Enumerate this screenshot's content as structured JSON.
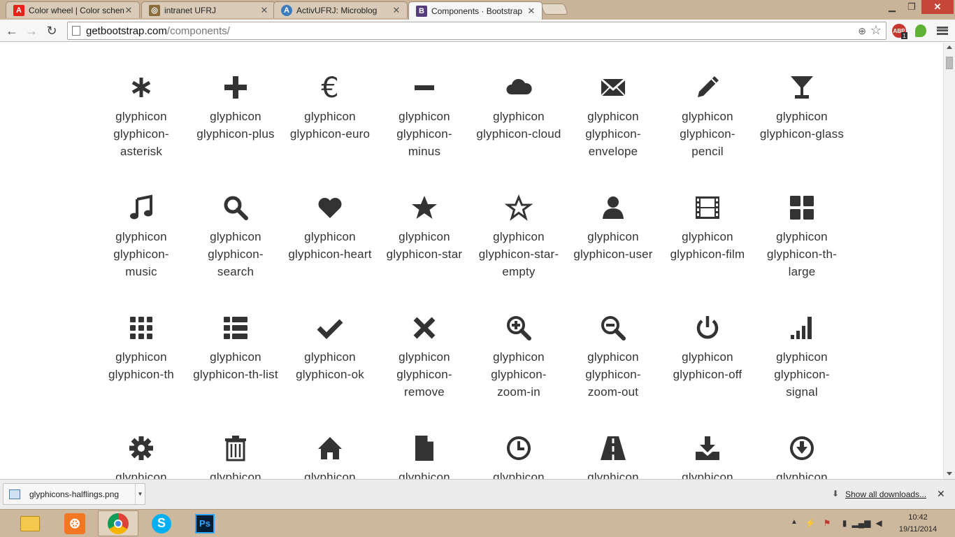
{
  "browser": {
    "tabs": [
      {
        "title": "Color wheel | Color schem",
        "favicon_name": "adobe-icon",
        "favicon_color": "#e1251b",
        "favicon_glyph": "A"
      },
      {
        "title": "intranet UFRJ",
        "favicon_name": "ufrj-icon",
        "favicon_color": "#8a6d3b",
        "favicon_glyph": "◎"
      },
      {
        "title": "ActivUFRJ: Microblog",
        "favicon_name": "activufrj-icon",
        "favicon_color": "#3b7bbf",
        "favicon_glyph": "A"
      },
      {
        "title": "Components · Bootstrap",
        "favicon_name": "bootstrap-icon",
        "favicon_color": "#563d7c",
        "favicon_glyph": "B"
      }
    ],
    "url_host": "getbootstrap.com",
    "url_path": "/components/",
    "extension_badge": "1"
  },
  "page": {
    "glyphicon_rows": [
      [
        {
          "icon": "asterisk",
          "label": "glyphicon glyphicon-asterisk"
        },
        {
          "icon": "plus",
          "label": "glyphicon glyphicon-plus"
        },
        {
          "icon": "euro",
          "label": "glyphicon glyphicon-euro"
        },
        {
          "icon": "minus",
          "label": "glyphicon glyphicon-minus"
        },
        {
          "icon": "cloud",
          "label": "glyphicon glyphicon-cloud"
        },
        {
          "icon": "envelope",
          "label": "glyphicon glyphicon-envelope"
        },
        {
          "icon": "pencil",
          "label": "glyphicon glyphicon-pencil"
        },
        {
          "icon": "glass",
          "label": "glyphicon glyphicon-glass"
        }
      ],
      [
        {
          "icon": "music",
          "label": "glyphicon glyphicon-music"
        },
        {
          "icon": "search",
          "label": "glyphicon glyphicon-search"
        },
        {
          "icon": "heart",
          "label": "glyphicon glyphicon-heart"
        },
        {
          "icon": "star",
          "label": "glyphicon glyphicon-star"
        },
        {
          "icon": "star-empty",
          "label": "glyphicon glyphicon-star-empty"
        },
        {
          "icon": "user",
          "label": "glyphicon glyphicon-user"
        },
        {
          "icon": "film",
          "label": "glyphicon glyphicon-film"
        },
        {
          "icon": "th-large",
          "label": "glyphicon glyphicon-th-large"
        }
      ],
      [
        {
          "icon": "th",
          "label": "glyphicon glyphicon-th"
        },
        {
          "icon": "th-list",
          "label": "glyphicon glyphicon-th-list"
        },
        {
          "icon": "ok",
          "label": "glyphicon glyphicon-ok"
        },
        {
          "icon": "remove",
          "label": "glyphicon glyphicon-remove"
        },
        {
          "icon": "zoom-in",
          "label": "glyphicon glyphicon-zoom-in"
        },
        {
          "icon": "zoom-out",
          "label": "glyphicon glyphicon-zoom-out"
        },
        {
          "icon": "off",
          "label": "glyphicon glyphicon-off"
        },
        {
          "icon": "signal",
          "label": "glyphicon glyphicon-signal"
        }
      ],
      [
        {
          "icon": "cog",
          "label": "glyphicon"
        },
        {
          "icon": "trash",
          "label": "glyphicon"
        },
        {
          "icon": "home",
          "label": "glyphicon"
        },
        {
          "icon": "file",
          "label": "glyphicon"
        },
        {
          "icon": "time",
          "label": "glyphicon"
        },
        {
          "icon": "road",
          "label": "glyphicon"
        },
        {
          "icon": "download-alt",
          "label": "glyphicon"
        },
        {
          "icon": "download",
          "label": "glyphicon"
        }
      ]
    ],
    "icon_color": "#333333",
    "link_color": "#428bca"
  },
  "downloads": {
    "item_filename": "glyphicons-halflings.png",
    "show_all_label": "Show all downloads..."
  },
  "taskbar": {
    "apps": [
      "explorer-icon",
      "xampp-icon",
      "chrome-icon",
      "skype-icon",
      "photoshop-icon"
    ],
    "xampp_glyph": "⊛",
    "skype_glyph": "S",
    "photoshop_glyph": "Ps",
    "clock_time": "10:42",
    "clock_date": "19/11/2014"
  }
}
